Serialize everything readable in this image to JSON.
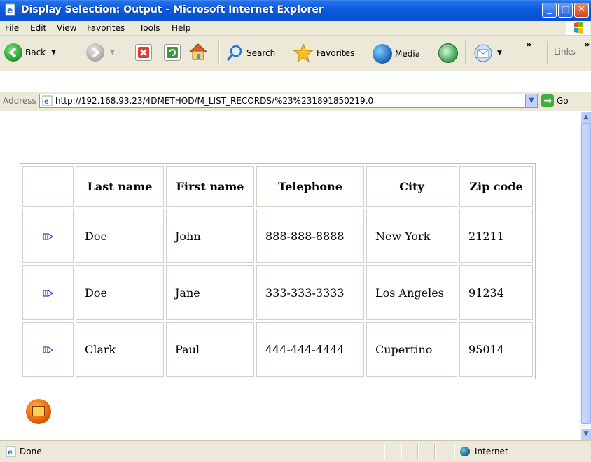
{
  "window": {
    "title": "Display Selection: Output - Microsoft Internet Explorer"
  },
  "menu": [
    "File",
    "Edit",
    "View",
    "Favorites",
    "Tools",
    "Help"
  ],
  "toolbar": {
    "back": "Back",
    "search": "Search",
    "favorites": "Favorites",
    "media": "Media",
    "links": "Links",
    "chevron": "»"
  },
  "address": {
    "label": "Address",
    "url": "http://192.168.93.23/4DMETHOD/M_LIST_RECORDS/%23%231891850219.0",
    "go": "Go"
  },
  "table": {
    "headers": [
      "",
      "Last name",
      "First name",
      "Telephone",
      "City",
      "Zip code"
    ],
    "rows": [
      [
        "Doe",
        "John",
        "888-888-8888",
        "New York",
        "21211"
      ],
      [
        "Doe",
        "Jane",
        "333-333-3333",
        "Los Angeles",
        "91234"
      ],
      [
        "Clark",
        "Paul",
        "444-444-4444",
        "Cupertino",
        "95014"
      ]
    ]
  },
  "status": {
    "text": "Done",
    "zone": "Internet"
  },
  "colors": {
    "titlebar": "#0855d6",
    "chrome": "#ece9d8",
    "go": "#3fae3f"
  }
}
